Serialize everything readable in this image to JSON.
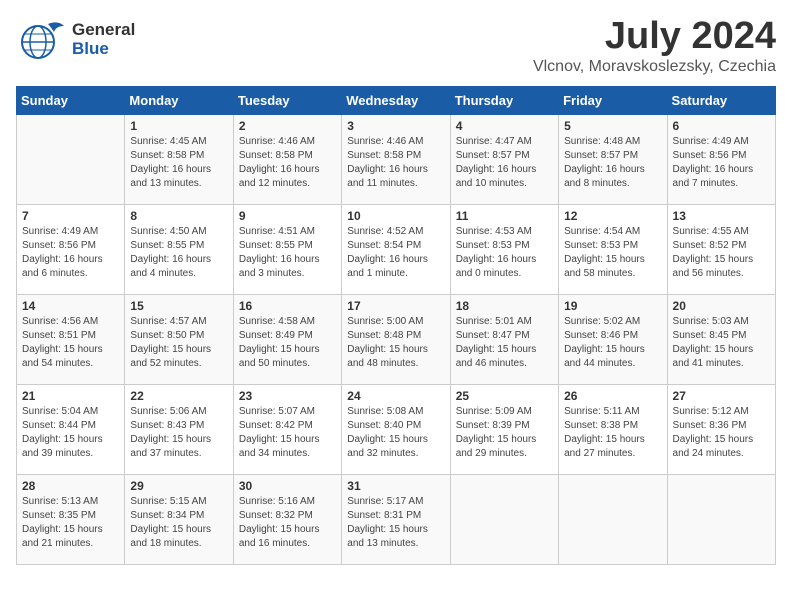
{
  "logo": {
    "general": "General",
    "blue": "Blue"
  },
  "title": {
    "month_year": "July 2024",
    "location": "Vlcnov, Moravskoslezsky, Czechia"
  },
  "days_of_week": [
    "Sunday",
    "Monday",
    "Tuesday",
    "Wednesday",
    "Thursday",
    "Friday",
    "Saturday"
  ],
  "weeks": [
    [
      {
        "day": "",
        "content": ""
      },
      {
        "day": "1",
        "content": "Sunrise: 4:45 AM\nSunset: 8:58 PM\nDaylight: 16 hours\nand 13 minutes."
      },
      {
        "day": "2",
        "content": "Sunrise: 4:46 AM\nSunset: 8:58 PM\nDaylight: 16 hours\nand 12 minutes."
      },
      {
        "day": "3",
        "content": "Sunrise: 4:46 AM\nSunset: 8:58 PM\nDaylight: 16 hours\nand 11 minutes."
      },
      {
        "day": "4",
        "content": "Sunrise: 4:47 AM\nSunset: 8:57 PM\nDaylight: 16 hours\nand 10 minutes."
      },
      {
        "day": "5",
        "content": "Sunrise: 4:48 AM\nSunset: 8:57 PM\nDaylight: 16 hours\nand 8 minutes."
      },
      {
        "day": "6",
        "content": "Sunrise: 4:49 AM\nSunset: 8:56 PM\nDaylight: 16 hours\nand 7 minutes."
      }
    ],
    [
      {
        "day": "7",
        "content": "Sunrise: 4:49 AM\nSunset: 8:56 PM\nDaylight: 16 hours\nand 6 minutes."
      },
      {
        "day": "8",
        "content": "Sunrise: 4:50 AM\nSunset: 8:55 PM\nDaylight: 16 hours\nand 4 minutes."
      },
      {
        "day": "9",
        "content": "Sunrise: 4:51 AM\nSunset: 8:55 PM\nDaylight: 16 hours\nand 3 minutes."
      },
      {
        "day": "10",
        "content": "Sunrise: 4:52 AM\nSunset: 8:54 PM\nDaylight: 16 hours\nand 1 minute."
      },
      {
        "day": "11",
        "content": "Sunrise: 4:53 AM\nSunset: 8:53 PM\nDaylight: 16 hours\nand 0 minutes."
      },
      {
        "day": "12",
        "content": "Sunrise: 4:54 AM\nSunset: 8:53 PM\nDaylight: 15 hours\nand 58 minutes."
      },
      {
        "day": "13",
        "content": "Sunrise: 4:55 AM\nSunset: 8:52 PM\nDaylight: 15 hours\nand 56 minutes."
      }
    ],
    [
      {
        "day": "14",
        "content": "Sunrise: 4:56 AM\nSunset: 8:51 PM\nDaylight: 15 hours\nand 54 minutes."
      },
      {
        "day": "15",
        "content": "Sunrise: 4:57 AM\nSunset: 8:50 PM\nDaylight: 15 hours\nand 52 minutes."
      },
      {
        "day": "16",
        "content": "Sunrise: 4:58 AM\nSunset: 8:49 PM\nDaylight: 15 hours\nand 50 minutes."
      },
      {
        "day": "17",
        "content": "Sunrise: 5:00 AM\nSunset: 8:48 PM\nDaylight: 15 hours\nand 48 minutes."
      },
      {
        "day": "18",
        "content": "Sunrise: 5:01 AM\nSunset: 8:47 PM\nDaylight: 15 hours\nand 46 minutes."
      },
      {
        "day": "19",
        "content": "Sunrise: 5:02 AM\nSunset: 8:46 PM\nDaylight: 15 hours\nand 44 minutes."
      },
      {
        "day": "20",
        "content": "Sunrise: 5:03 AM\nSunset: 8:45 PM\nDaylight: 15 hours\nand 41 minutes."
      }
    ],
    [
      {
        "day": "21",
        "content": "Sunrise: 5:04 AM\nSunset: 8:44 PM\nDaylight: 15 hours\nand 39 minutes."
      },
      {
        "day": "22",
        "content": "Sunrise: 5:06 AM\nSunset: 8:43 PM\nDaylight: 15 hours\nand 37 minutes."
      },
      {
        "day": "23",
        "content": "Sunrise: 5:07 AM\nSunset: 8:42 PM\nDaylight: 15 hours\nand 34 minutes."
      },
      {
        "day": "24",
        "content": "Sunrise: 5:08 AM\nSunset: 8:40 PM\nDaylight: 15 hours\nand 32 minutes."
      },
      {
        "day": "25",
        "content": "Sunrise: 5:09 AM\nSunset: 8:39 PM\nDaylight: 15 hours\nand 29 minutes."
      },
      {
        "day": "26",
        "content": "Sunrise: 5:11 AM\nSunset: 8:38 PM\nDaylight: 15 hours\nand 27 minutes."
      },
      {
        "day": "27",
        "content": "Sunrise: 5:12 AM\nSunset: 8:36 PM\nDaylight: 15 hours\nand 24 minutes."
      }
    ],
    [
      {
        "day": "28",
        "content": "Sunrise: 5:13 AM\nSunset: 8:35 PM\nDaylight: 15 hours\nand 21 minutes."
      },
      {
        "day": "29",
        "content": "Sunrise: 5:15 AM\nSunset: 8:34 PM\nDaylight: 15 hours\nand 18 minutes."
      },
      {
        "day": "30",
        "content": "Sunrise: 5:16 AM\nSunset: 8:32 PM\nDaylight: 15 hours\nand 16 minutes."
      },
      {
        "day": "31",
        "content": "Sunrise: 5:17 AM\nSunset: 8:31 PM\nDaylight: 15 hours\nand 13 minutes."
      },
      {
        "day": "",
        "content": ""
      },
      {
        "day": "",
        "content": ""
      },
      {
        "day": "",
        "content": ""
      }
    ]
  ]
}
